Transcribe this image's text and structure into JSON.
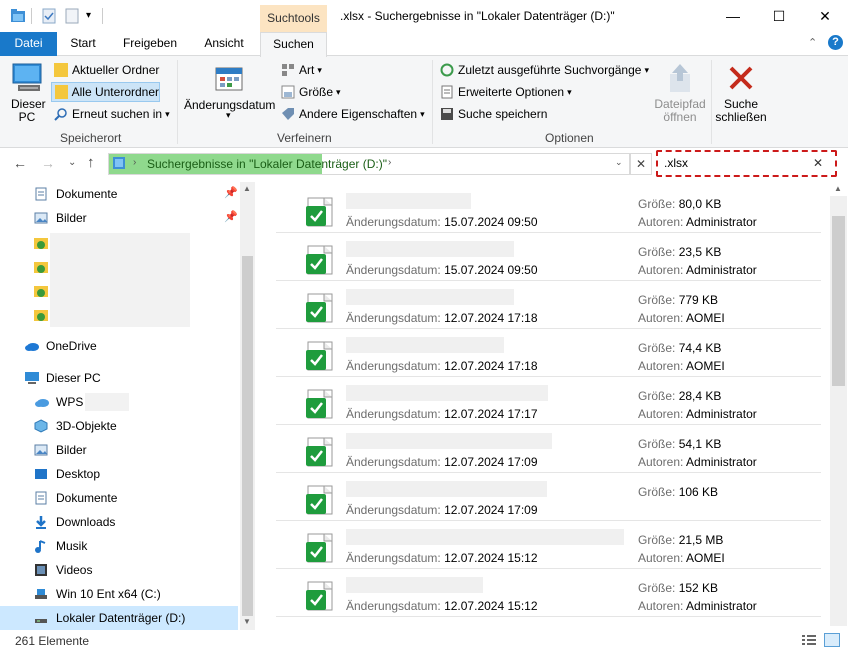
{
  "window": {
    "title": ".xlsx - Suchergebnisse in \"Lokaler Datenträger (D:)\"",
    "context_tab": "Suchtools",
    "minimize": "—",
    "maximize": "☐",
    "close": "✕"
  },
  "ribbon_tabs": [
    "Datei",
    "Start",
    "Freigeben",
    "Ansicht",
    "Suchen"
  ],
  "ribbon": {
    "location": {
      "this_pc": "Dieser PC",
      "current_folder": "Aktueller Ordner",
      "all_subfolders": "Alle Unterordner",
      "search_again": "Erneut suchen in",
      "group": "Speicherort"
    },
    "refine": {
      "date_modified": "Änderungsdatum",
      "type": "Art",
      "size": "Größe",
      "other_props": "Andere Eigenschaften",
      "group": "Verfeinern"
    },
    "options": {
      "recent_searches": "Zuletzt ausgeführte Suchvorgänge",
      "advanced": "Erweiterte Optionen",
      "save_search": "Suche speichern",
      "open_location": "Dateipfad öffnen",
      "close_search": "Suche schließen",
      "group": "Optionen"
    }
  },
  "address": {
    "path": "Suchergebnisse in \"Lokaler Datenträger (D:)\"",
    "search_value": ".xlsx",
    "search_clear": "✕"
  },
  "nav": {
    "quick": [
      {
        "label": "Dokumente",
        "icon": "document-icon",
        "pinned": true
      },
      {
        "label": "Bilder",
        "icon": "pictures-icon",
        "pinned": true
      }
    ],
    "onedrive": "OneDrive",
    "this_pc": "Dieser PC",
    "pc_items": [
      {
        "label": "WPS",
        "icon": "cloud-icon"
      },
      {
        "label": "3D-Objekte",
        "icon": "cube-icon"
      },
      {
        "label": "Bilder",
        "icon": "pictures-icon"
      },
      {
        "label": "Desktop",
        "icon": "desktop-icon"
      },
      {
        "label": "Dokumente",
        "icon": "document-icon"
      },
      {
        "label": "Downloads",
        "icon": "download-icon"
      },
      {
        "label": "Musik",
        "icon": "music-icon"
      },
      {
        "label": "Videos",
        "icon": "video-icon"
      },
      {
        "label": "Win 10 Ent x64 (C:)",
        "icon": "drive-icon"
      },
      {
        "label": "Lokaler Datenträger (D:)",
        "icon": "drive-icon",
        "selected": true
      }
    ]
  },
  "results_labels": {
    "date": "Änderungsdatum:",
    "size": "Größe:",
    "authors": "Autoren:"
  },
  "results": [
    {
      "date": "15.07.2024 09:50",
      "size": "80,0 KB",
      "author": "Administrator"
    },
    {
      "date": "15.07.2024 09:50",
      "size": "23,5 KB",
      "author": "Administrator"
    },
    {
      "date": "12.07.2024 17:18",
      "size": "779 KB",
      "author": "AOMEI"
    },
    {
      "date": "12.07.2024 17:18",
      "size": "74,4 KB",
      "author": "AOMEI"
    },
    {
      "date": "12.07.2024 17:17",
      "size": "28,4 KB",
      "author": "Administrator"
    },
    {
      "date": "12.07.2024 17:09",
      "size": "54,1 KB",
      "author": "Administrator"
    },
    {
      "date": "12.07.2024 17:09",
      "size": "106 KB",
      "author": ""
    },
    {
      "date": "12.07.2024 15:12",
      "size": "21,5 MB",
      "author": "AOMEI"
    },
    {
      "date": "12.07.2024 15:12",
      "size": "152 KB",
      "author": "Administrator"
    }
  ],
  "status": {
    "count": "261 Elemente"
  },
  "colors": {
    "accent": "#1979ca",
    "context_tab": "#fce4c2",
    "search_highlight": "#cc1a1a",
    "address_fill": "#8fd98d",
    "excel_green": "#1f9c3d"
  }
}
